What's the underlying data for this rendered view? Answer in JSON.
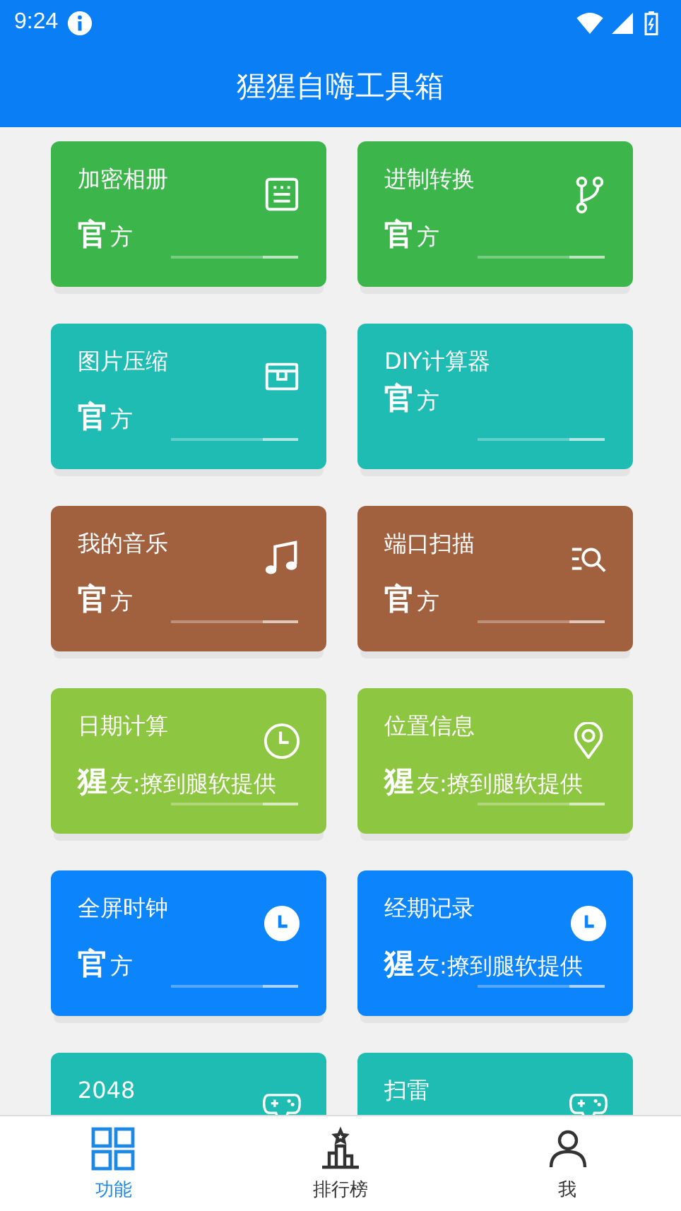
{
  "status_bar": {
    "time": "9:24"
  },
  "app_bar": {
    "title": "猩猩自嗨工具箱"
  },
  "cards": [
    {
      "title": "加密相册",
      "color": "#3cb64b",
      "source_mark": "官",
      "source_rest": "方"
    },
    {
      "title": "进制转换",
      "color": "#3cb64b",
      "source_mark": "官",
      "source_rest": "方"
    },
    {
      "title": "图片压缩",
      "color": "#1fbcb3",
      "source_mark": "官",
      "source_rest": "方"
    },
    {
      "title": "DIY计算器",
      "color": "#1fbcb3",
      "source_mark": "官",
      "source_rest": "方"
    },
    {
      "title": "我的音乐",
      "color": "#a1613f",
      "source_mark": "官",
      "source_rest": "方"
    },
    {
      "title": "端口扫描",
      "color": "#a1613f",
      "source_mark": "官",
      "source_rest": "方"
    },
    {
      "title": "日期计算",
      "color": "#8dc641",
      "source_mark": "猩",
      "source_rest": "友:撩到腿软提供"
    },
    {
      "title": "位置信息",
      "color": "#8dc641",
      "source_mark": "猩",
      "source_rest": "友:撩到腿软提供"
    },
    {
      "title": "全屏时钟",
      "color": "#0b84fc",
      "source_mark": "官",
      "source_rest": "方"
    },
    {
      "title": "经期记录",
      "color": "#0b84fc",
      "source_mark": "猩",
      "source_rest": "友:撩到腿软提供"
    },
    {
      "title": "2048",
      "color": "#1fbcb3"
    },
    {
      "title": "扫雷",
      "color": "#1fbcb3"
    }
  ],
  "nav": [
    {
      "label": "功能",
      "selected": true
    },
    {
      "label": "排行榜",
      "selected": false
    },
    {
      "label": "我",
      "selected": false
    }
  ]
}
